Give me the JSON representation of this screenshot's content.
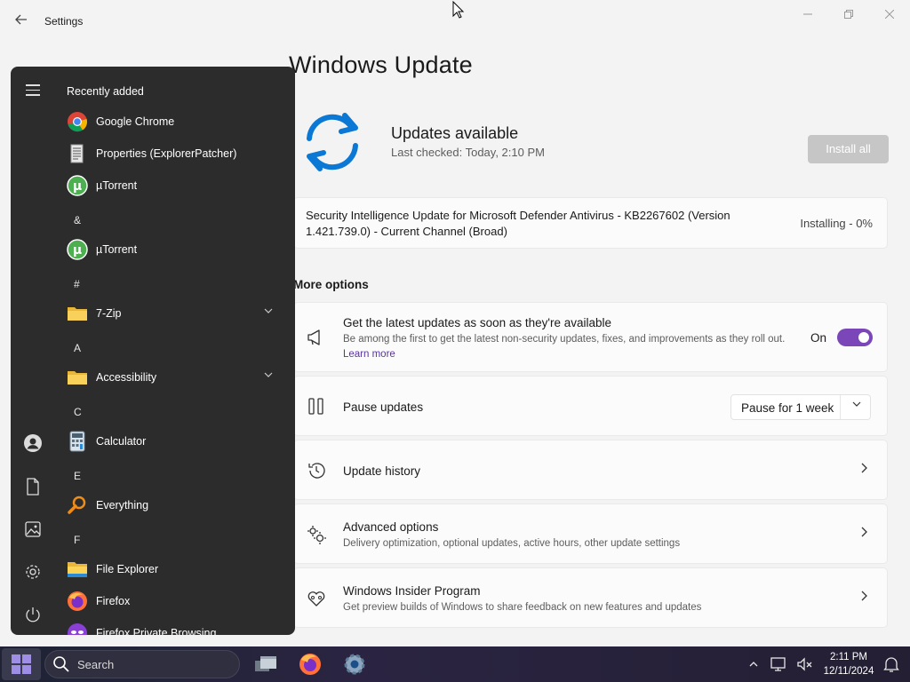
{
  "window": {
    "title": "Settings",
    "minimize": "—",
    "maximize": "▢",
    "close": "✕"
  },
  "page": {
    "title": "Windows Update",
    "status_title": "Updates available",
    "last_checked": "Last checked: Today, 2:10 PM",
    "install_all": "Install all"
  },
  "pending_update": {
    "name": "Security Intelligence Update for Microsoft Defender Antivirus - KB2267602 (Version 1.421.739.0) - Current Channel (Broad)",
    "status": "Installing - 0%"
  },
  "more_options": {
    "heading": "More options",
    "latest": {
      "title": "Get the latest updates as soon as they're available",
      "desc": "Be among the first to get the latest non-security updates, fixes, and improvements as they roll out.",
      "learn_more": "Learn more",
      "toggle_label": "On",
      "toggle_on": true,
      "accent": "#7a46b8"
    },
    "pause": {
      "title": "Pause updates",
      "selected": "Pause for 1 week"
    },
    "history": {
      "title": "Update history"
    },
    "advanced": {
      "title": "Advanced options",
      "desc": "Delivery optimization, optional updates, active hours, other update settings"
    },
    "insider": {
      "title": "Windows Insider Program",
      "desc": "Get preview builds of Windows to share feedback on new features and updates"
    }
  },
  "start_menu": {
    "section_title": "Recently added",
    "items": [
      {
        "label": "Google Chrome",
        "icon": "chrome-icon"
      },
      {
        "label": "Properties (ExplorerPatcher)",
        "icon": "properties-icon"
      },
      {
        "label": "µTorrent",
        "icon": "utorrent-icon"
      },
      {
        "letter": "&"
      },
      {
        "label": "µTorrent",
        "icon": "utorrent-icon"
      },
      {
        "letter": "#"
      },
      {
        "label": "7-Zip",
        "icon": "folder-icon",
        "expandable": true
      },
      {
        "letter": "A"
      },
      {
        "label": "Accessibility",
        "icon": "folder-icon",
        "expandable": true
      },
      {
        "letter": "C"
      },
      {
        "label": "Calculator",
        "icon": "calculator-icon"
      },
      {
        "letter": "E"
      },
      {
        "label": "Everything",
        "icon": "everything-icon"
      },
      {
        "letter": "F"
      },
      {
        "label": "File Explorer",
        "icon": "file-explorer-icon"
      },
      {
        "label": "Firefox",
        "icon": "firefox-icon"
      },
      {
        "label": "Firefox Private Browsing",
        "icon": "firefox-private-icon"
      }
    ],
    "rail_icons": [
      "user-icon",
      "documents-icon",
      "pictures-icon",
      "settings-icon",
      "power-icon"
    ]
  },
  "taskbar": {
    "search_placeholder": "Search",
    "time": "2:11 PM",
    "date": "12/11/2024",
    "tray_icons": [
      "chevron-up-icon",
      "network-icon",
      "volume-muted-icon",
      "notification-bell-icon"
    ]
  }
}
